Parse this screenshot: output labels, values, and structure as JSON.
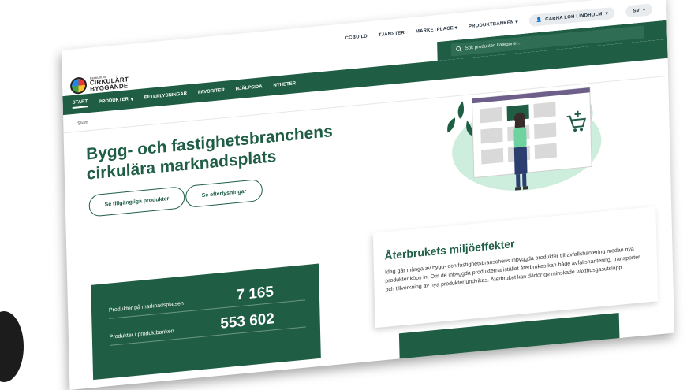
{
  "topbar": {
    "links": [
      "CCBUILD",
      "TJÄNSTER",
      "MARKETPLACE",
      "PRODUKTBANKEN"
    ],
    "user_name": "CARNA LOH LINDHOLM",
    "language": "SV"
  },
  "logo": {
    "line_small": "Centrum för",
    "line_big_1": "CIRKULÄRT",
    "line_big_2": "BYGGANDE"
  },
  "search": {
    "placeholder": "Sök produkter, kategorier..."
  },
  "nav": {
    "items": [
      "START",
      "PRODUKTER",
      "EFTERLYSNINGAR",
      "FAVORITER",
      "HJÄLPSIDA",
      "NYHETER"
    ]
  },
  "breadcrumb": "Start",
  "hero": {
    "title": "Bygg- och fastighetsbranchens cirkulära marknadsplats",
    "btn_products": "Se tillgängliga produkter",
    "btn_requests": "Se efterlysningar"
  },
  "stats": [
    {
      "label": "Produkter på marknadsplatsen",
      "value": "7 165"
    },
    {
      "label": "Produkter i produktbanken",
      "value": "553 602"
    }
  ],
  "environment": {
    "title": "Återbrukets miljöeffekter",
    "text": "Idag går många av bygg- och fastighetsbranschens inbyggda produkter till avfallshantering medan nya produkter köps in. Om de inbyggda produkterna istället återbrukas kan både avfallshantering, transporter och tillverkning av nya produkter undvikas. Återbruket kan därför ge minskade växthusgasutsläpp"
  },
  "colors": {
    "brand_green": "#1f5e45",
    "light_green": "#9fd9b8"
  }
}
